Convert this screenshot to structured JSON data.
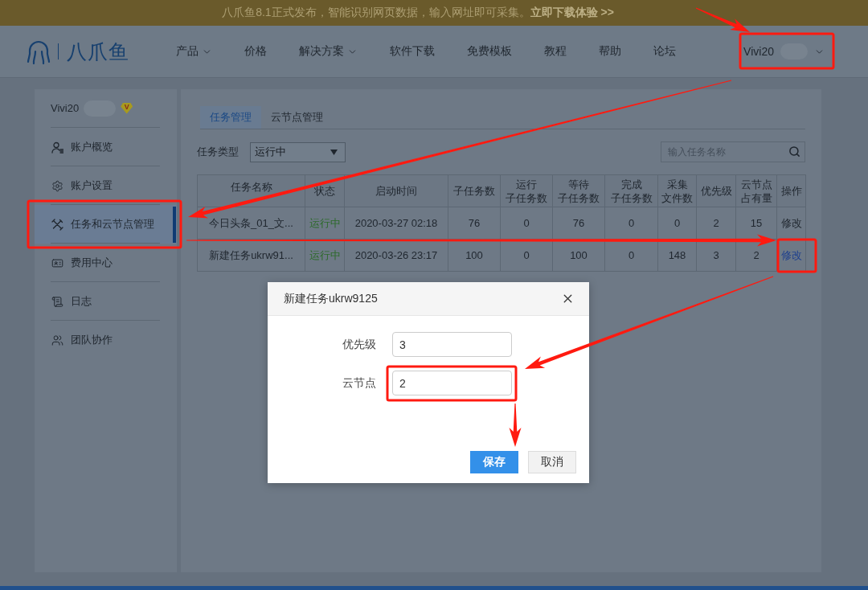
{
  "banner": {
    "text": "八爪鱼8.1正式发布，智能识别网页数据，输入网址即可采集。",
    "link": "立即下载体验 >>"
  },
  "header": {
    "logo_text": "八爪鱼",
    "nav": [
      {
        "label": "产品",
        "has_menu": true
      },
      {
        "label": "价格",
        "has_menu": false
      },
      {
        "label": "解决方案",
        "has_menu": true
      },
      {
        "label": "软件下载",
        "has_menu": false
      },
      {
        "label": "免费模板",
        "has_menu": false
      },
      {
        "label": "教程",
        "has_menu": false
      },
      {
        "label": "帮助",
        "has_menu": false
      },
      {
        "label": "论坛",
        "has_menu": false
      }
    ],
    "user": "Vivi20"
  },
  "sidebar": {
    "user": {
      "name": "Vivi20",
      "badge": "V"
    },
    "items": [
      {
        "label": "账户概览",
        "selected": false
      },
      {
        "label": "账户设置",
        "selected": false
      },
      {
        "label": "任务和云节点管理",
        "selected": true
      },
      {
        "label": "费用中心",
        "selected": false
      },
      {
        "label": "日志",
        "selected": false
      },
      {
        "label": "团队协作",
        "selected": false
      }
    ]
  },
  "main": {
    "tabs": [
      {
        "label": "任务管理",
        "selected": true
      },
      {
        "label": "云节点管理",
        "selected": false
      }
    ],
    "filter": {
      "label": "任务类型",
      "value": "运行中"
    },
    "search": {
      "placeholder": "输入任务名称"
    },
    "table": {
      "columns": [
        {
          "lines": [
            "任务名称"
          ]
        },
        {
          "lines": [
            "状态"
          ]
        },
        {
          "lines": [
            "启动时间"
          ]
        },
        {
          "lines": [
            "子任务数"
          ]
        },
        {
          "lines": [
            "运行",
            "子任务数"
          ]
        },
        {
          "lines": [
            "等待",
            "子任务数"
          ]
        },
        {
          "lines": [
            "完成",
            "子任务数"
          ]
        },
        {
          "lines": [
            "采集",
            "文件数"
          ]
        },
        {
          "lines": [
            "优先级"
          ]
        },
        {
          "lines": [
            "云节点",
            "占有量"
          ]
        },
        {
          "lines": [
            "操作"
          ]
        }
      ],
      "rows": [
        {
          "name": "今日头条_01_文...",
          "status": "运行中",
          "start_time": "2020-03-27 02:18",
          "subtasks": "76",
          "running": "0",
          "waiting": "76",
          "done": "0",
          "files": "0",
          "priority": "2",
          "nodes": "15",
          "action": {
            "label": "修改",
            "active": false
          }
        },
        {
          "name": "新建任务ukrw91...",
          "status": "运行中",
          "start_time": "2020-03-26 23:17",
          "subtasks": "100",
          "running": "0",
          "waiting": "100",
          "done": "0",
          "files": "148",
          "priority": "3",
          "nodes": "2",
          "action": {
            "label": "修改",
            "active": true
          }
        }
      ]
    }
  },
  "dialog": {
    "title": "新建任务ukrw9125",
    "fields": [
      {
        "label": "优先级",
        "value": "3"
      },
      {
        "label": "云节点",
        "value": "2"
      }
    ],
    "buttons": [
      {
        "label": "保存",
        "kind": "primary"
      },
      {
        "label": "取消",
        "kind": "default"
      }
    ]
  }
}
